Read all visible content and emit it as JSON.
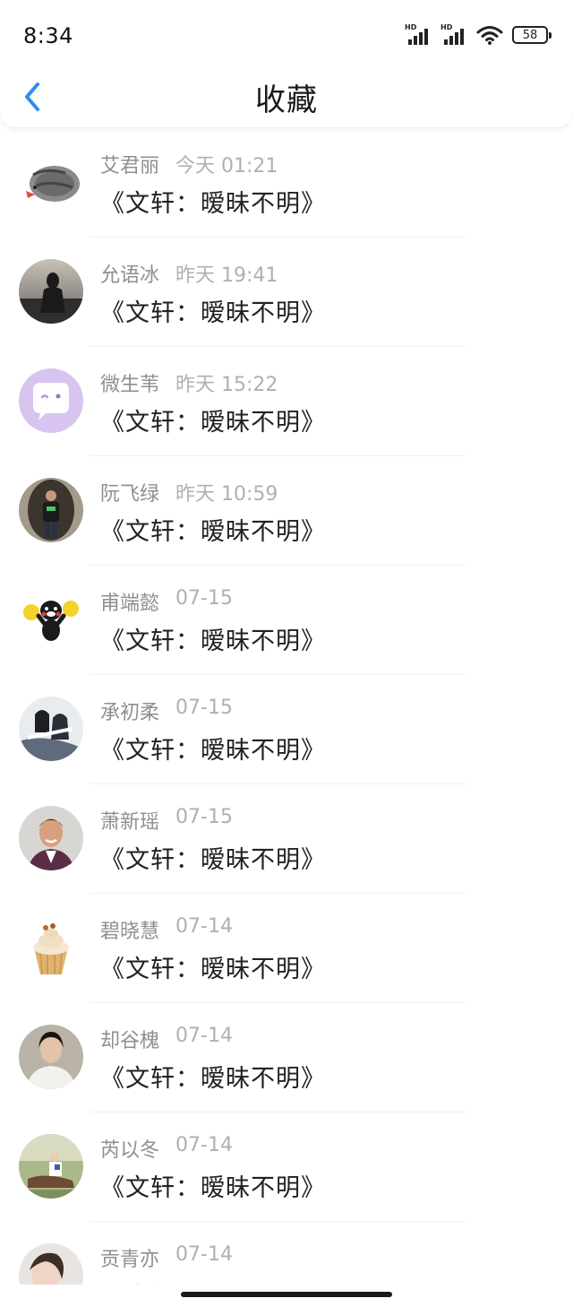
{
  "status_bar": {
    "time": "8:34",
    "battery": "58",
    "sim1_label": "HD",
    "sim2_label": "HD"
  },
  "header": {
    "title": "收藏",
    "back_icon": "chevron-left-icon",
    "accent_color": "#2d8cf0"
  },
  "items": [
    {
      "name": "艾君丽",
      "time": "今天 01:21",
      "content": "《文轩：暧昧不明》",
      "avatar": "cat-avatar"
    },
    {
      "name": "允语冰",
      "time": "昨天 19:41",
      "content": "《文轩：暧昧不明》",
      "avatar": "sunset-girl-avatar"
    },
    {
      "name": "微生苇",
      "time": "昨天 15:22",
      "content": "《文轩：暧昧不明》",
      "avatar": "chat-bubble-avatar"
    },
    {
      "name": "阮飞绿",
      "time": "昨天 10:59",
      "content": "《文轩：暧昧不明》",
      "avatar": "man-cave-avatar"
    },
    {
      "name": "甫端懿",
      "time": "07-15",
      "content": "《文轩：暧昧不明》",
      "avatar": "kumamon-avatar"
    },
    {
      "name": "承初柔",
      "time": "07-15",
      "content": "《文轩：暧昧不明》",
      "avatar": "anime-pair-avatar"
    },
    {
      "name": "萧新瑶",
      "time": "07-15",
      "content": "《文轩：暧昧不明》",
      "avatar": "man-smile-avatar"
    },
    {
      "name": "碧晓慧",
      "time": "07-14",
      "content": "《文轩：暧昧不明》",
      "avatar": "cupcake-avatar"
    },
    {
      "name": "却谷槐",
      "time": "07-14",
      "content": "《文轩：暧昧不明》",
      "avatar": "man-white-avatar"
    },
    {
      "name": "芮以冬",
      "time": "07-14",
      "content": "《文轩：暧昧不明》",
      "avatar": "painting-avatar"
    },
    {
      "name": "贡青亦",
      "time": "07-14",
      "content": "《文轩：暧昧不明》",
      "avatar": "woman-cat-avatar"
    }
  ]
}
